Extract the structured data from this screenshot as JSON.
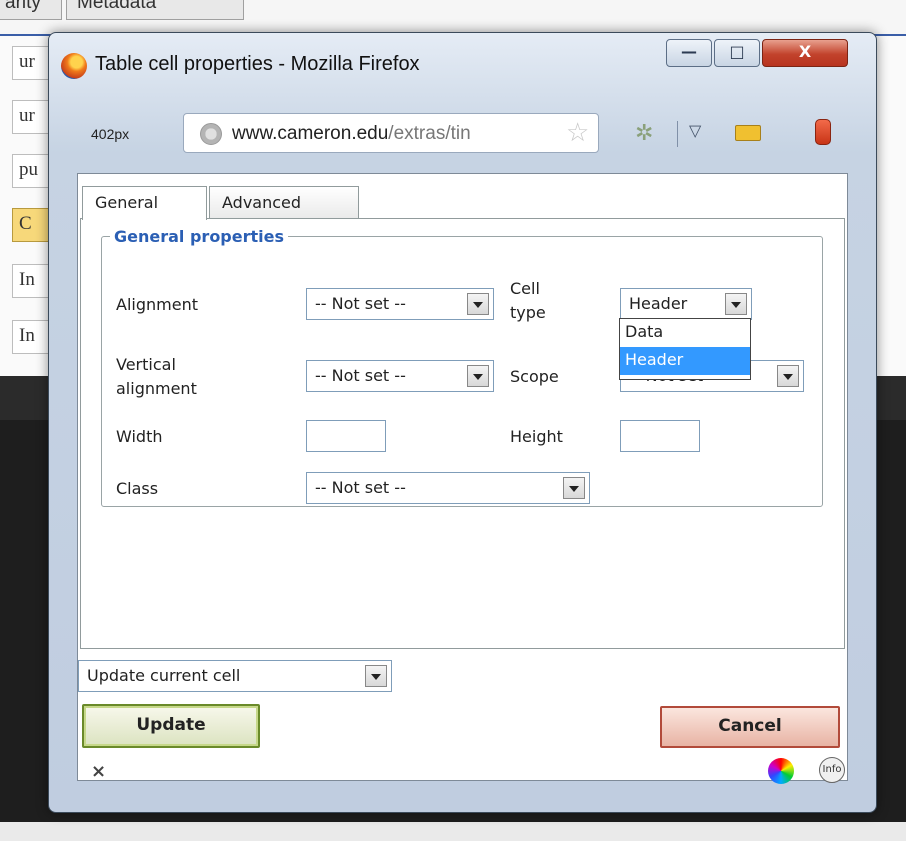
{
  "background": {
    "tabs": [
      "arity",
      "Metadata"
    ],
    "fields": [
      "ur",
      "ur",
      "pu",
      "C",
      "In",
      "In"
    ]
  },
  "window": {
    "title": "Table cell properties - Mozilla Firefox",
    "size_label": "402px",
    "url_domain": "www.cameron.edu",
    "url_path": "/extras/tin",
    "controls": {
      "minimize": "—",
      "maximize": "□",
      "close": "X"
    }
  },
  "dialog": {
    "tabs": {
      "general": "General",
      "advanced": "Advanced",
      "active": "General"
    },
    "legend": "General properties",
    "alignment_label": "Alignment",
    "alignment_value": "-- Not set --",
    "celltype_label_1": "Cell",
    "celltype_label_2": "type",
    "celltype_value": "Header",
    "celltype_options": [
      "Data",
      "Header"
    ],
    "valign_label_1": "Vertical",
    "valign_label_2": "alignment",
    "valign_value": "-- Not set --",
    "scope_label": "Scope",
    "scope_value": "-- Not set --",
    "width_label": "Width",
    "width_value": "",
    "height_label": "Height",
    "height_value": "",
    "class_label": "Class",
    "class_value": "-- Not set --",
    "action_select": "Update current cell",
    "update_button": "Update",
    "cancel_button": "Cancel"
  },
  "status": {
    "close_glyph": "×",
    "info_label": "Info"
  }
}
